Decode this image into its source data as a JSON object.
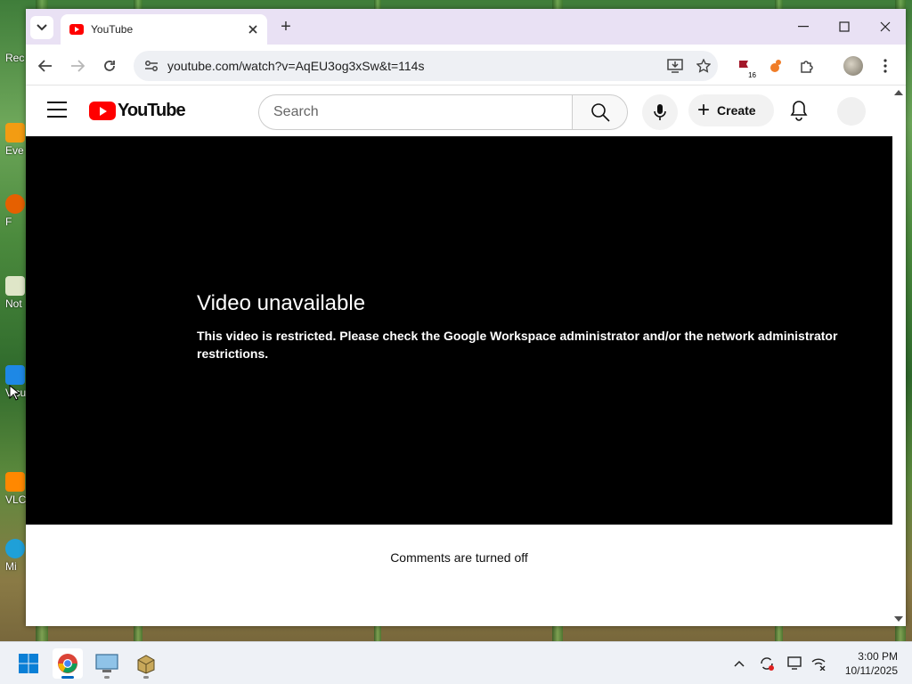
{
  "desktop": {
    "icons": [
      {
        "label": "Rec"
      },
      {
        "label": "Eve"
      },
      {
        "label": "F"
      },
      {
        "label": "Not"
      },
      {
        "label": "Visu"
      },
      {
        "label": "VLC"
      },
      {
        "label": "Mi"
      }
    ]
  },
  "browser": {
    "tab": {
      "title": "YouTube",
      "close_icon": "close-icon"
    },
    "new_tab_label": "+",
    "url": "youtube.com/watch?v=AqEU3og3xSw&t=114s",
    "extension_badge": "16"
  },
  "youtube": {
    "logo_text": "YouTube",
    "search": {
      "placeholder": "Search"
    },
    "create_label": "Create",
    "player": {
      "error_title": "Video unavailable",
      "error_message": "This video is restricted. Please check the Google Workspace administrator and/or the network administrator restrictions."
    },
    "comments_text": "Comments are turned off"
  },
  "taskbar": {
    "time": "3:00 PM",
    "date": "10/11/2025"
  },
  "colors": {
    "yt_red": "#ff0000",
    "titlebar": "#e9e1f4",
    "player_bg": "#000000",
    "taskbar_accent": "#0067c0"
  }
}
